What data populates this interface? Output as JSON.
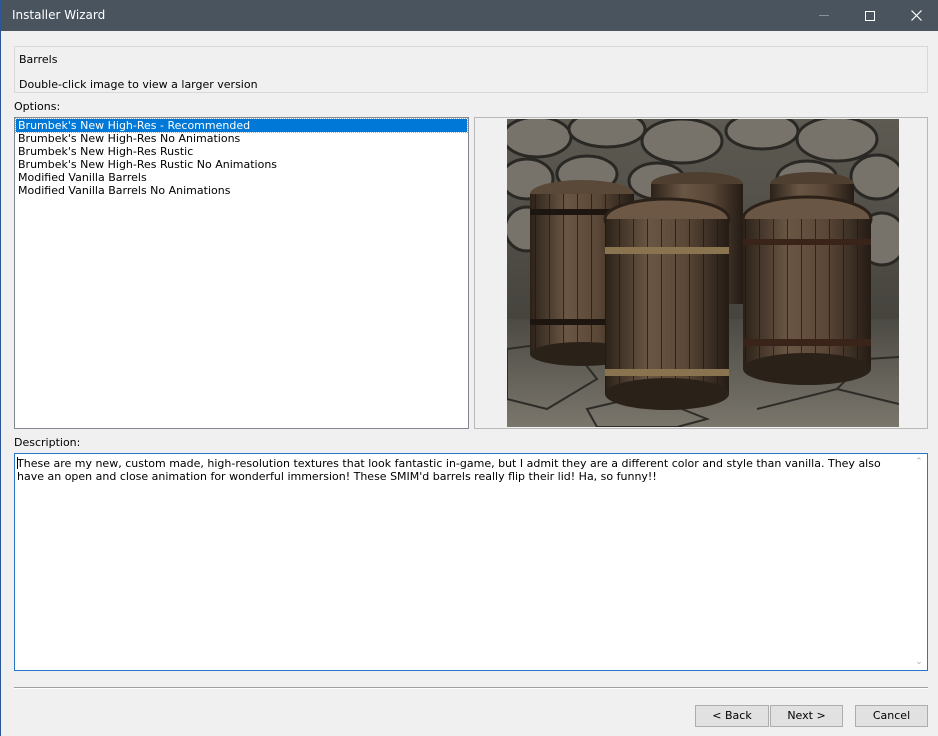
{
  "window": {
    "title": "Installer Wizard"
  },
  "header": {
    "name": "Barrels",
    "hint": "Double-click image to view a larger version"
  },
  "options": {
    "label": "Options:",
    "items": [
      "Brumbek's New High-Res - Recommended",
      "Brumbek's New High-Res No Animations",
      "Brumbek's New High-Res Rustic",
      "Brumbek's New High-Res Rustic No Animations",
      "Modified Vanilla Barrels",
      "Modified Vanilla Barrels No Animations"
    ],
    "selected_index": 0
  },
  "preview": {
    "icon": "barrels-preview-image"
  },
  "description": {
    "label": "Description:",
    "text": "These are my new, custom made, high-resolution textures that look fantastic in-game, but I admit they are a different color and style than vanilla. They also have an open and close animation for wonderful immersion! These SMIM'd barrels really flip their lid! Ha, so funny!!"
  },
  "buttons": {
    "back": "< Back",
    "next": "Next >",
    "cancel": "Cancel"
  },
  "colors": {
    "titlebar": "#4a545f",
    "selection": "#0078d7",
    "focus_border": "#2677c7"
  }
}
